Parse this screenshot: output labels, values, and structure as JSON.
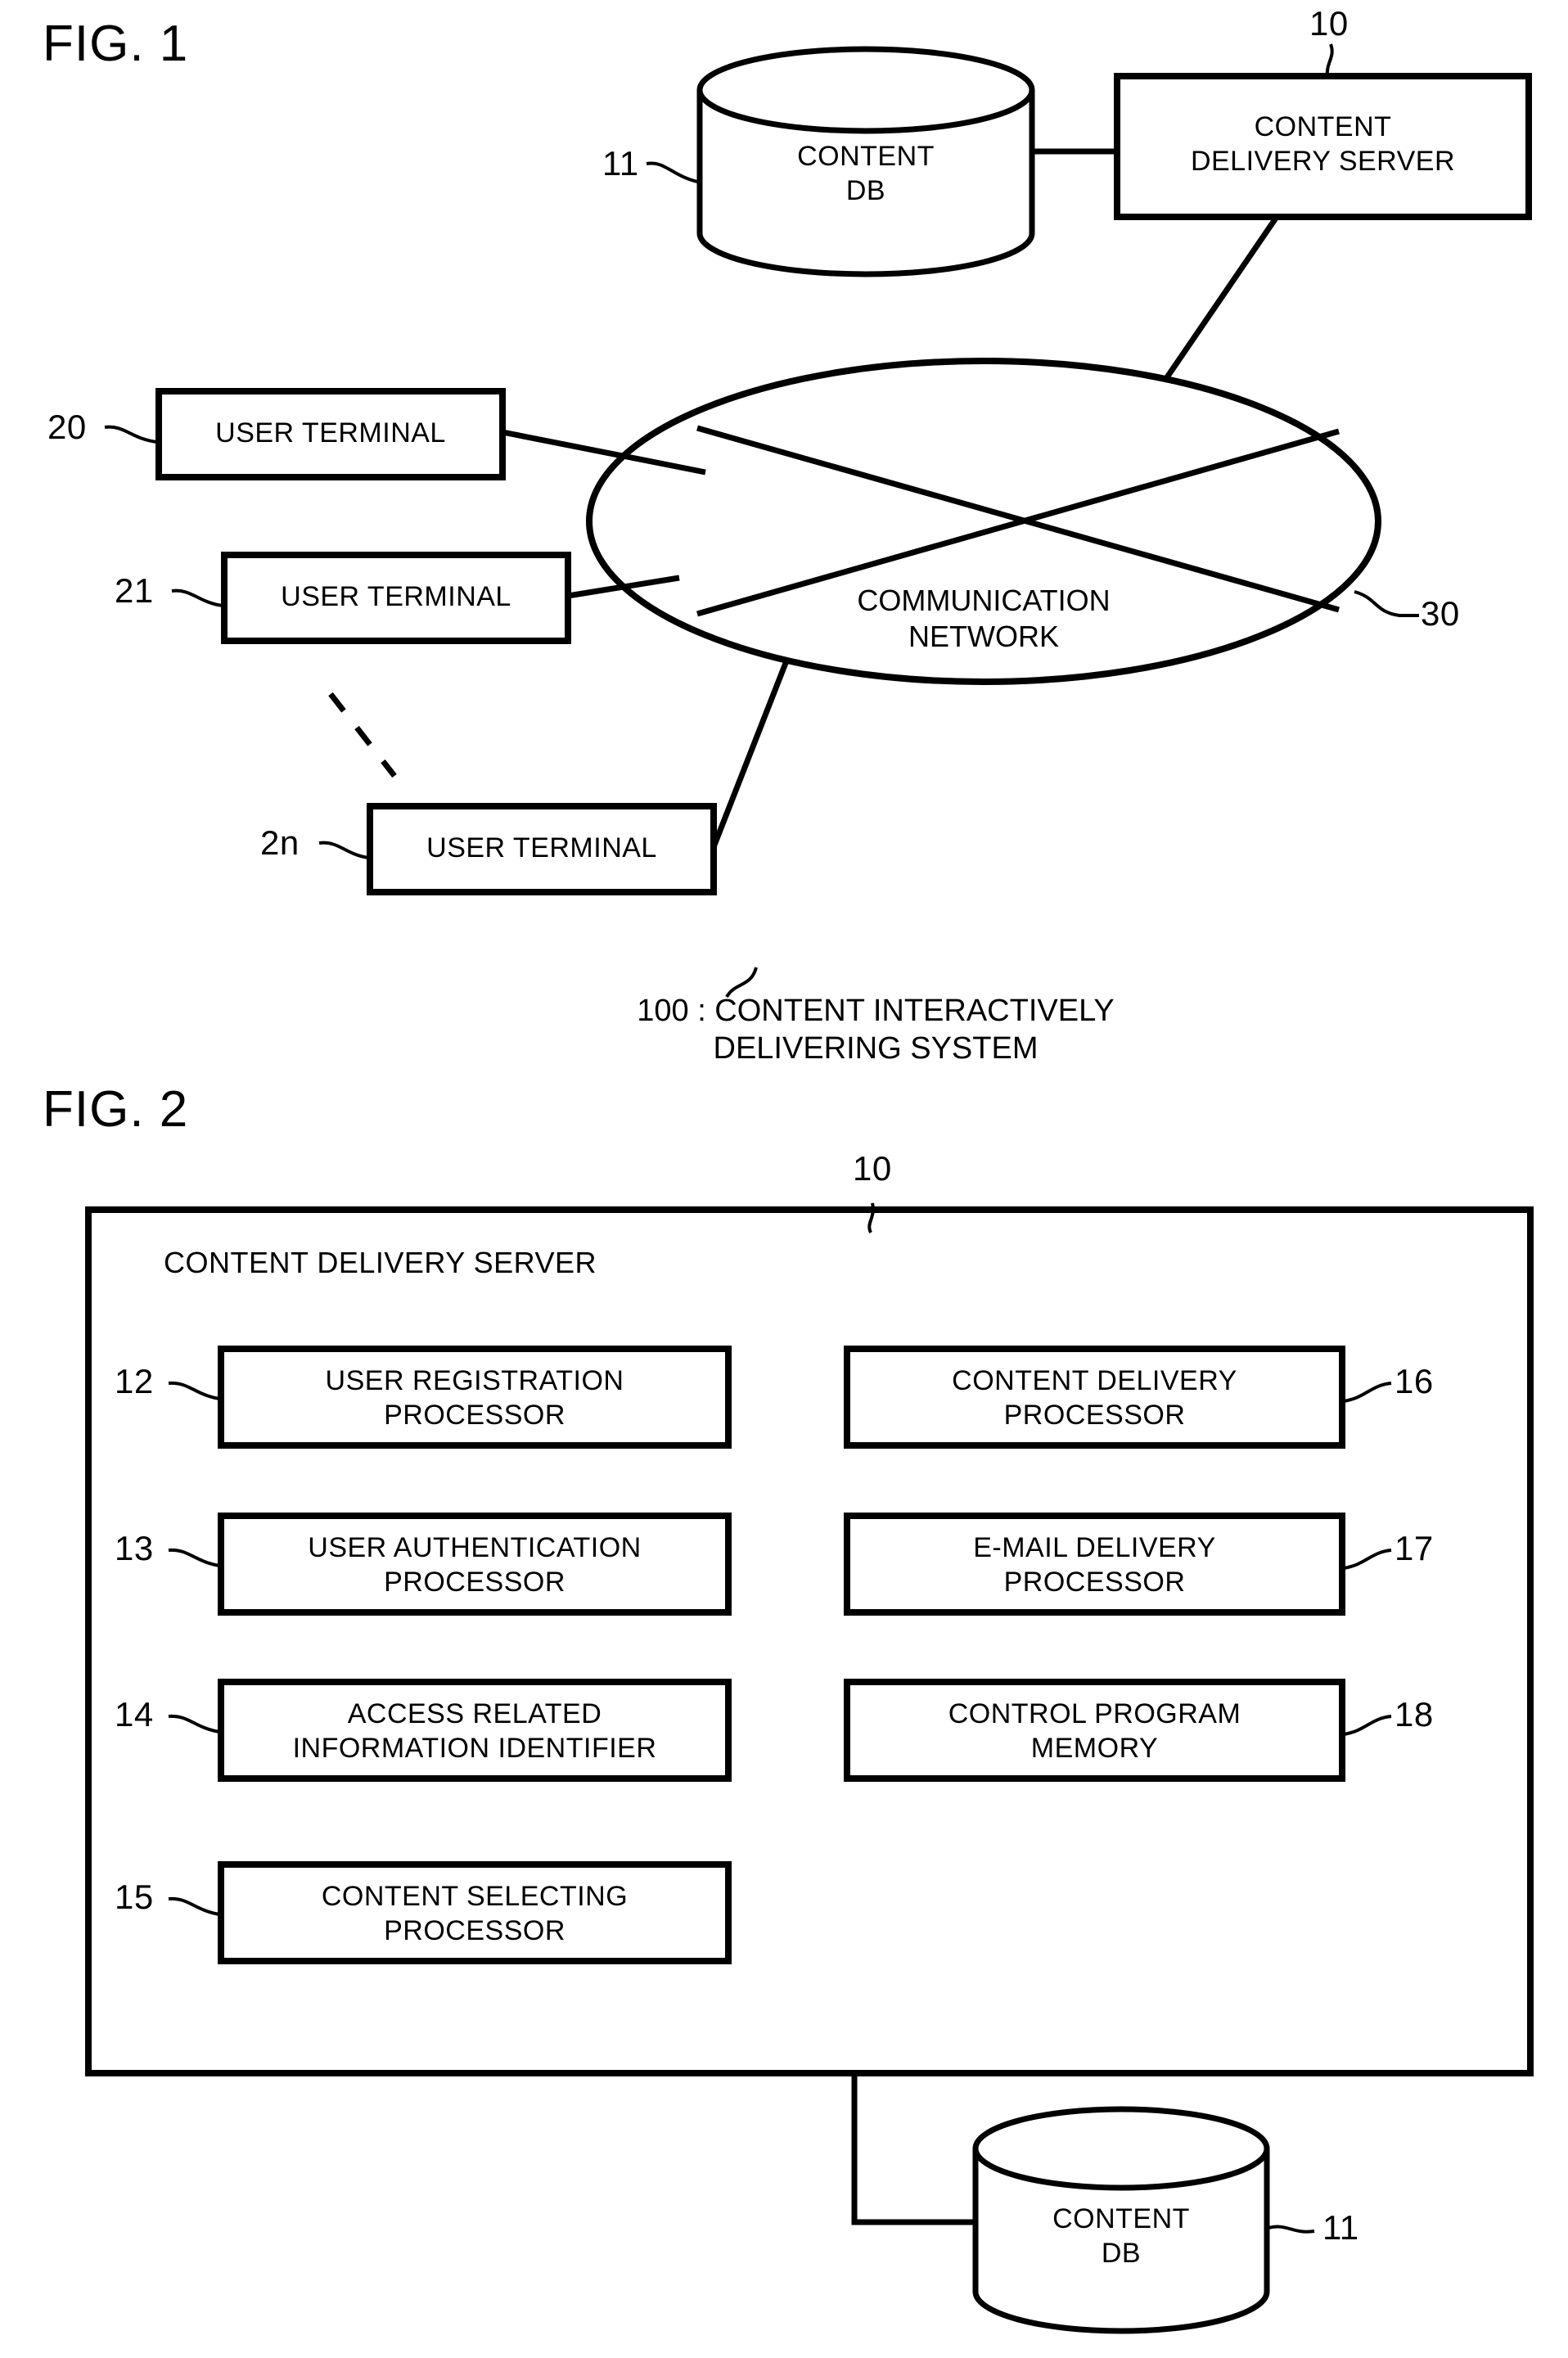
{
  "figures": [
    {
      "title": "FIG. 1",
      "caption": {
        "ref": "100",
        "line1": "100 : CONTENT INTERACTIVELY",
        "line2": "DELIVERING SYSTEM"
      },
      "nodes": {
        "content_db": {
          "label_line1": "CONTENT",
          "label_line2": "DB",
          "ref": "11"
        },
        "delivery_server": {
          "label_line1": "CONTENT",
          "label_line2": "DELIVERY SERVER",
          "ref": "10"
        },
        "network": {
          "label_line1": "COMMUNICATION",
          "label_line2": "NETWORK",
          "ref": "30"
        },
        "terminals": [
          {
            "label": "USER TERMINAL",
            "ref": "20"
          },
          {
            "label": "USER TERMINAL",
            "ref": "21"
          },
          {
            "label": "USER TERMINAL",
            "ref": "2n"
          }
        ]
      }
    },
    {
      "title": "FIG. 2",
      "server": {
        "title": "CONTENT DELIVERY SERVER",
        "ref": "10"
      },
      "left_modules": [
        {
          "ref": "12",
          "line1": "USER REGISTRATION",
          "line2": "PROCESSOR"
        },
        {
          "ref": "13",
          "line1": "USER AUTHENTICATION",
          "line2": "PROCESSOR"
        },
        {
          "ref": "14",
          "line1": "ACCESS RELATED",
          "line2": "INFORMATION IDENTIFIER"
        },
        {
          "ref": "15",
          "line1": "CONTENT SELECTING",
          "line2": "PROCESSOR"
        }
      ],
      "right_modules": [
        {
          "ref": "16",
          "line1": "CONTENT DELIVERY",
          "line2": "PROCESSOR"
        },
        {
          "ref": "17",
          "line1": "E-MAIL DELIVERY",
          "line2": "PROCESSOR"
        },
        {
          "ref": "18",
          "line1": "CONTROL PROGRAM",
          "line2": "MEMORY"
        }
      ],
      "database": {
        "line1": "CONTENT",
        "line2": "DB",
        "ref": "11"
      }
    }
  ],
  "colors": {
    "ink": "#000000",
    "paper": "#ffffff"
  }
}
